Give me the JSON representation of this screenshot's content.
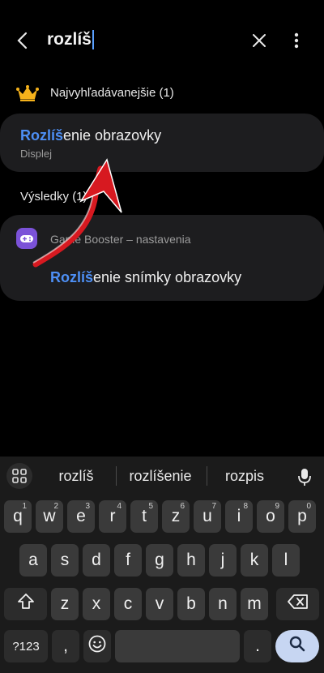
{
  "search": {
    "query": "rozlíš"
  },
  "most_searched": {
    "label": "Najvyhľadávanejšie (1)",
    "item": {
      "title_highlight": "Rozlíš",
      "title_rest": "enie obrazovky",
      "subtitle": "Displej"
    }
  },
  "results": {
    "label": "Výsledky (1)",
    "item": {
      "app": "Game Booster – nastavenia",
      "title_highlight": "Rozlíš",
      "title_rest": "enie snímky obrazovky"
    }
  },
  "keyboard": {
    "suggestions": [
      "rozlíš",
      "rozlíšenie",
      "rozpis"
    ],
    "row1": [
      {
        "k": "q",
        "h": "1"
      },
      {
        "k": "w",
        "h": "2"
      },
      {
        "k": "e",
        "h": "3"
      },
      {
        "k": "r",
        "h": "4"
      },
      {
        "k": "t",
        "h": "5"
      },
      {
        "k": "z",
        "h": "6"
      },
      {
        "k": "u",
        "h": "7"
      },
      {
        "k": "i",
        "h": "8"
      },
      {
        "k": "o",
        "h": "9"
      },
      {
        "k": "p",
        "h": "0"
      }
    ],
    "row2": [
      "a",
      "s",
      "d",
      "f",
      "g",
      "h",
      "j",
      "k",
      "l"
    ],
    "row3": [
      "z",
      "x",
      "c",
      "v",
      "b",
      "n",
      "m"
    ],
    "sym_label": "?123",
    "comma": ",",
    "period": "."
  },
  "colors": {
    "highlight": "#4d8ff5",
    "card": "#1d1d1f",
    "search_key": "#c7d6f2",
    "annotation_arrow": "#d71920"
  },
  "icons": [
    "back-arrow-icon",
    "close-icon",
    "more-vert-icon",
    "crown-icon",
    "game-booster-icon",
    "grid-icon",
    "mic-icon",
    "shift-icon",
    "backspace-icon",
    "emoji-icon",
    "search-icon"
  ]
}
